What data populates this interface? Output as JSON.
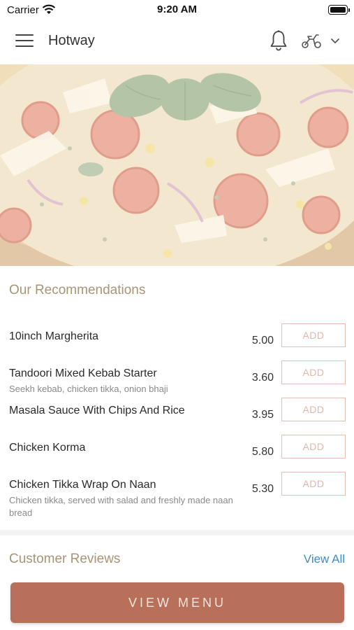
{
  "status_bar": {
    "carrier": "Carrier",
    "time": "9:20 AM"
  },
  "header": {
    "title": "Hotway",
    "icons": [
      "menu-icon",
      "bell-icon",
      "scooter-icon",
      "chevron-down-icon"
    ]
  },
  "hero": {
    "image": "pizza-photo"
  },
  "recommendations": {
    "title": "Our Recommendations",
    "items": [
      {
        "name": "10inch Margherita",
        "description": "",
        "price": "5.00",
        "button": "ADD"
      },
      {
        "name": "Tandoori Mixed Kebab Starter",
        "description": "Seekh kebab, chicken tikka, onion bhaji",
        "price": "3.60",
        "button": "ADD"
      },
      {
        "name": "Masala Sauce With Chips And Rice",
        "description": "",
        "price": "3.95",
        "button": "ADD"
      },
      {
        "name": "Chicken Korma",
        "description": "",
        "price": "5.80",
        "button": "ADD"
      },
      {
        "name": "Chicken Tikka Wrap On Naan",
        "description": "Chicken tikka, served with salad and freshly made naan bread",
        "price": "5.30",
        "button": "ADD"
      }
    ]
  },
  "reviews": {
    "title": "Customer Reviews",
    "view_all": "View All"
  },
  "footer": {
    "button": "VIEW MENU"
  },
  "colors": {
    "accent": "#b8705a",
    "section_title": "#a89574",
    "link": "#3b8fc2",
    "add_border": "#e6bfb2"
  }
}
